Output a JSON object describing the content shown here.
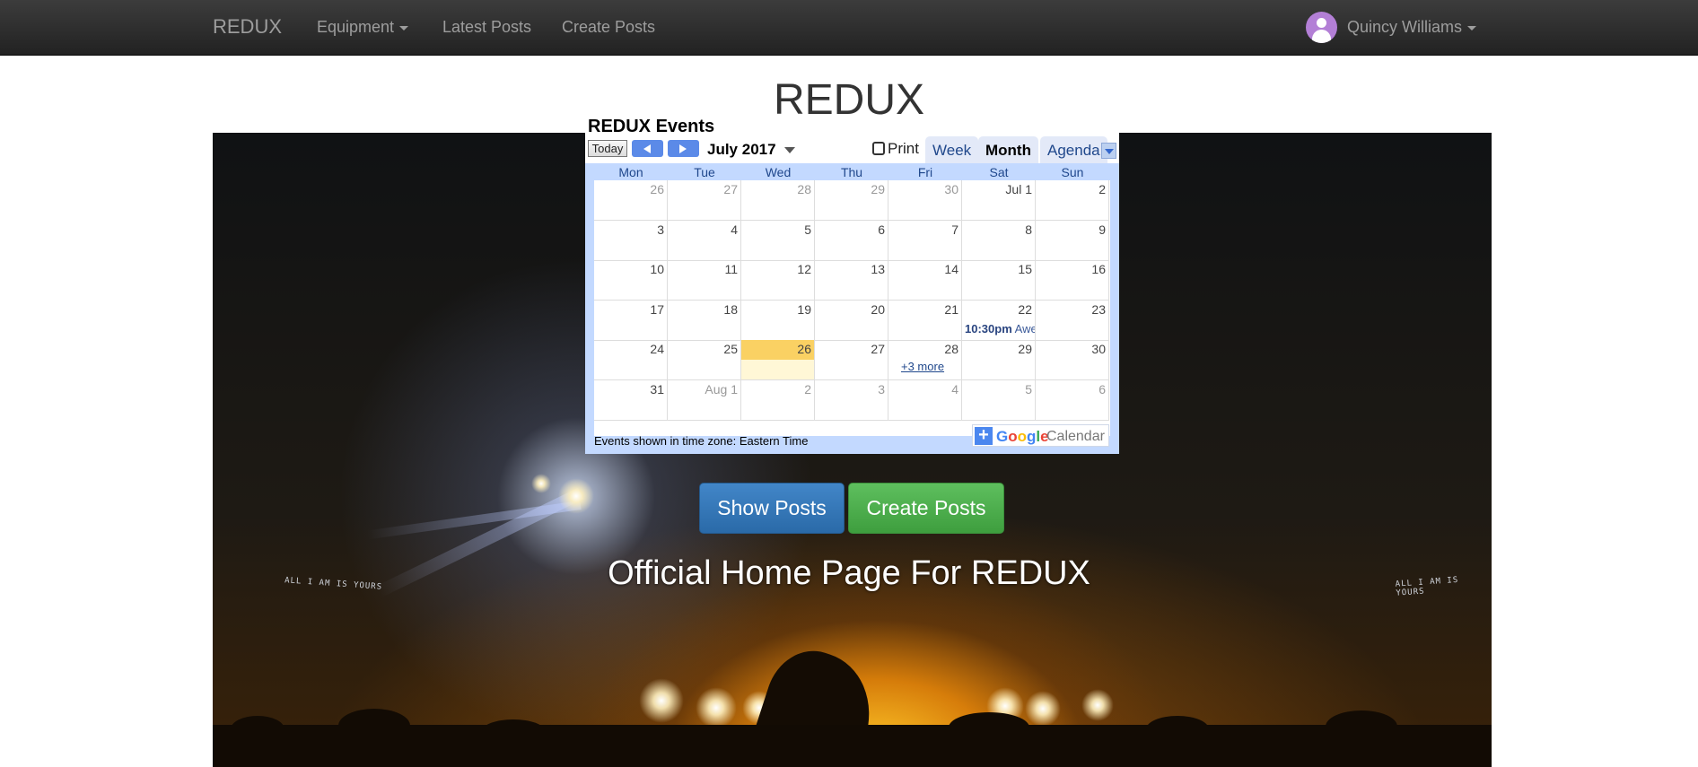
{
  "navbar": {
    "brand": "REDUX",
    "items": [
      {
        "label": "Equipment",
        "dropdown": true
      },
      {
        "label": "Latest Posts",
        "dropdown": false
      },
      {
        "label": "Create Posts",
        "dropdown": false
      }
    ],
    "user": {
      "name": "Quincy Williams",
      "icon": "user-avatar-icon",
      "avatar_color": "#b37fd6"
    }
  },
  "page": {
    "title": "REDUX",
    "tagline": "Official Home Page For REDUX"
  },
  "calendar": {
    "title": "REDUX Events",
    "today_label": "Today",
    "month_label": "July 2017",
    "print_label": "Print",
    "views": [
      "Week",
      "Month",
      "Agenda"
    ],
    "active_view": "Month",
    "days_of_week": [
      "Mon",
      "Tue",
      "Wed",
      "Thu",
      "Fri",
      "Sat",
      "Sun"
    ],
    "weeks": [
      [
        "26",
        "27",
        "28",
        "29",
        "30",
        "Jul 1",
        "2"
      ],
      [
        "3",
        "4",
        "5",
        "6",
        "7",
        "8",
        "9"
      ],
      [
        "10",
        "11",
        "12",
        "13",
        "14",
        "15",
        "16"
      ],
      [
        "17",
        "18",
        "19",
        "20",
        "21",
        "22",
        "23"
      ],
      [
        "24",
        "25",
        "26",
        "27",
        "28",
        "29",
        "30"
      ],
      [
        "31",
        "Aug 1",
        "2",
        "3",
        "4",
        "5",
        "6"
      ]
    ],
    "event": {
      "time": "10:30pm",
      "title": "Awe"
    },
    "more_label": "+3 more",
    "timezone_note": "Events shown in time zone: Eastern Time",
    "google_word": "Google",
    "calendar_word": "Calendar",
    "today_color": "#fad163",
    "header_color": "#c3d9ff"
  },
  "buttons": {
    "show_posts": "Show Posts",
    "create_posts": "Create Posts",
    "show_color": "#337ab7",
    "create_color": "#5cb85c"
  },
  "hero_texts": [
    "ALL I AM IS YOURS",
    "ALL I AM IS YOURS"
  ]
}
